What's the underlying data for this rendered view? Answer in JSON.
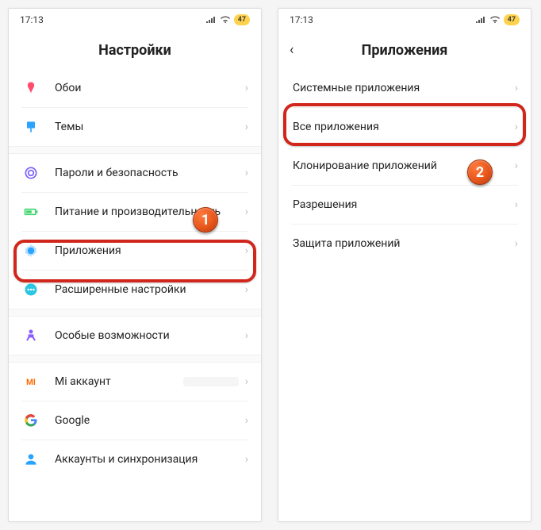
{
  "statusbar": {
    "time": "17:13",
    "battery": "47"
  },
  "screen1": {
    "title": "Настройки",
    "items": [
      {
        "label": "Обои"
      },
      {
        "label": "Темы"
      },
      {
        "label": "Пароли и безопасность"
      },
      {
        "label": "Питание и производительность"
      },
      {
        "label": "Приложения"
      },
      {
        "label": "Расширенные настройки"
      },
      {
        "label": "Особые возможности"
      },
      {
        "label": "Mi аккаунт"
      },
      {
        "label": "Google"
      },
      {
        "label": "Аккаунты и синхронизация"
      }
    ]
  },
  "screen2": {
    "title": "Приложения",
    "items": [
      {
        "label": "Системные приложения"
      },
      {
        "label": "Все приложения"
      },
      {
        "label": "Клонирование приложений"
      },
      {
        "label": "Разрешения"
      },
      {
        "label": "Защита приложений"
      }
    ]
  },
  "badges": {
    "one": "1",
    "two": "2"
  }
}
